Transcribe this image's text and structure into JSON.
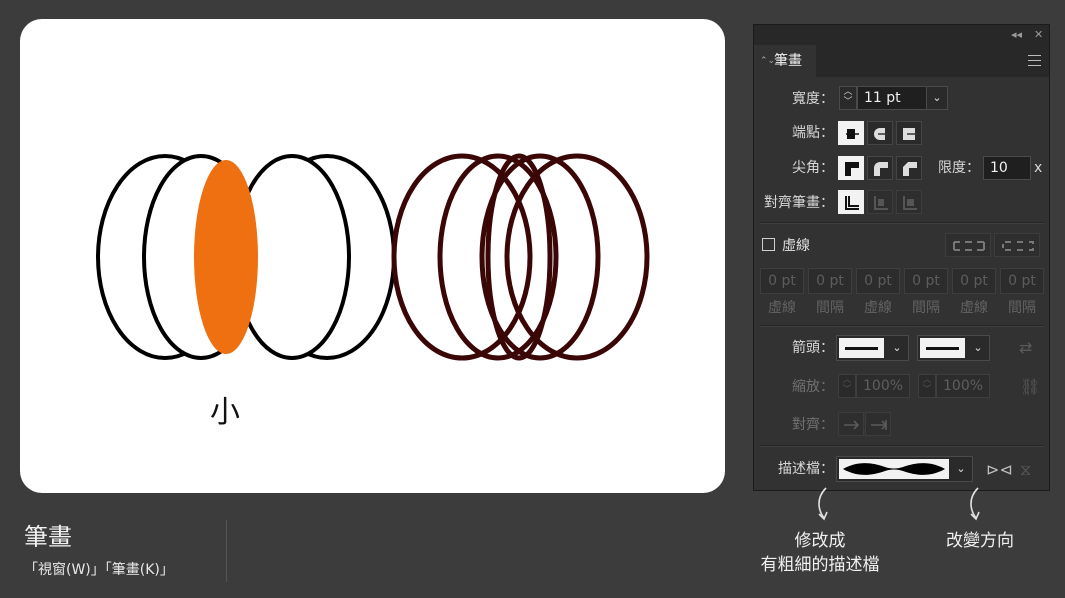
{
  "canvas": {
    "small_label": "小",
    "colors": {
      "fill_highlight": "#ee7011",
      "left_stroke": "#000000",
      "right_stroke": "#3a0606"
    }
  },
  "footer": {
    "title": "筆畫",
    "subtitle": "「視窗(W)」「筆畫(K)」"
  },
  "panel": {
    "tab": "筆畫",
    "icons": {
      "collapse": "double-chevron-left-icon",
      "close": "close-icon",
      "menu": "hamburger-menu-icon"
    },
    "width_label": "寬度：",
    "width_value": "11 pt",
    "cap_label": "端點：",
    "corner_label": "尖角：",
    "limit_label": "限度：",
    "limit_value": "10",
    "limit_unit": "x",
    "align_label": "對齊筆畫：",
    "dashed_label": "虛線",
    "dash_values": [
      "0 pt",
      "0 pt",
      "0 pt",
      "0 pt",
      "0 pt",
      "0 pt"
    ],
    "dash_labels": [
      "虛線",
      "間隔",
      "虛線",
      "間隔",
      "虛線",
      "間隔"
    ],
    "arrowheads_label": "箭頭：",
    "scale_label": "縮放：",
    "scale_start": "100%",
    "scale_end": "100%",
    "arrow_align_label": "對齊：",
    "profile_label": "描述檔："
  },
  "annotations": {
    "profile_note_line1": "修改成",
    "profile_note_line2": "有粗細的描述檔",
    "direction_note": "改變方向"
  }
}
